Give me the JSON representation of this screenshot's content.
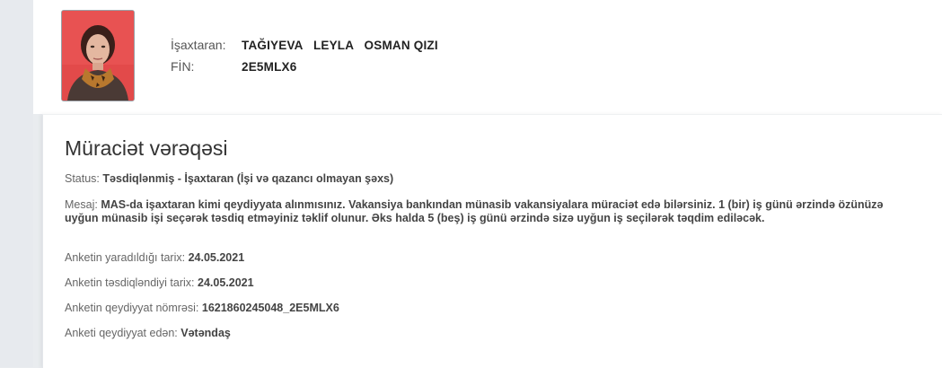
{
  "applicant": {
    "name_label": "İşaxtaran:",
    "name_value": "TAĞIYEVA   LEYLA   OSMAN QIZI",
    "fin_label": "FİN:",
    "fin_value": "2E5MLX6"
  },
  "application": {
    "title": "Müraciət vərəqəsi",
    "status_label": "Status:",
    "status_value": "Təsdiqlənmiş - İşaxtaran (İşi və qazancı olmayan şəxs)",
    "message_label": "Mesaj:",
    "message_value": "MAS-da işaxtaran kimi qeydiyyata alınmısınız. Vakansiya bankından münasib vakansiyalara müraciət edə bilərsiniz. 1 (bir) iş günü ərzində özünüzə uyğun münasib işi seçərək təsdiq etməyiniz təklif olunur. Əks halda 5 (beş) iş günü ərzində sizə uyğun iş seçilərək təqdim ediləcək.",
    "created_label": "Anketin yaradıldığı tarix:",
    "created_value": "24.05.2021",
    "approved_label": "Anketin təsdiqləndiyi tarix:",
    "approved_value": "24.05.2021",
    "regnum_label": "Anketin qeydiyyat nömrəsi:",
    "regnum_value": "1621860245048_2E5MLX6",
    "registered_by_label": "Anketi qeydiyyat edən:",
    "registered_by_value": "Vətəndaş"
  },
  "colors": {
    "background": "#e9ecef",
    "panel": "#ffffff",
    "photo_background": "#e24a4a"
  }
}
